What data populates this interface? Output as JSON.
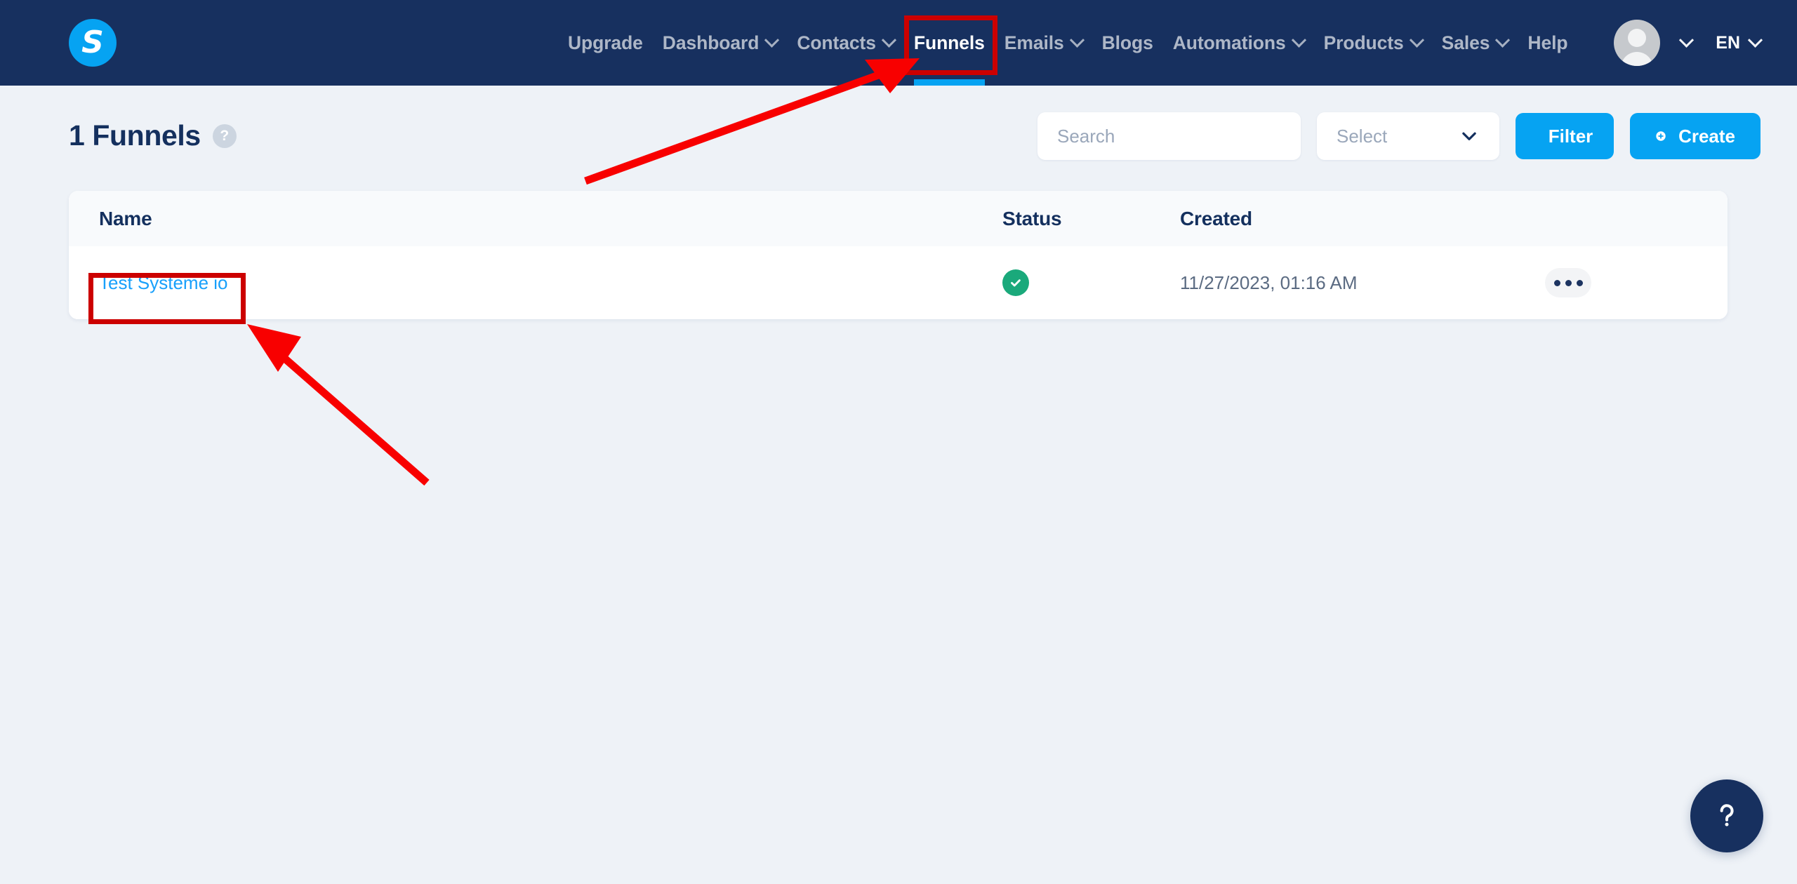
{
  "brand": {
    "letter": "S",
    "name": "systeme-io-logo"
  },
  "navbar": {
    "items": [
      {
        "label": "Upgrade",
        "has_dropdown": false,
        "active": false
      },
      {
        "label": "Dashboard",
        "has_dropdown": true,
        "active": false
      },
      {
        "label": "Contacts",
        "has_dropdown": true,
        "active": false
      },
      {
        "label": "Funnels",
        "has_dropdown": false,
        "active": true
      },
      {
        "label": "Emails",
        "has_dropdown": true,
        "active": false
      },
      {
        "label": "Blogs",
        "has_dropdown": false,
        "active": false
      },
      {
        "label": "Automations",
        "has_dropdown": true,
        "active": false
      },
      {
        "label": "Products",
        "has_dropdown": true,
        "active": false
      },
      {
        "label": "Sales",
        "has_dropdown": true,
        "active": false
      },
      {
        "label": "Help",
        "has_dropdown": false,
        "active": false
      }
    ],
    "language": "EN",
    "bg_color": "#17305f",
    "active_underline_color": "#06a3f2"
  },
  "header": {
    "title": "1 Funnels",
    "help_badge": "?"
  },
  "toolbar": {
    "search_placeholder": "Search",
    "search_value": "",
    "select_placeholder": "Select",
    "filter_label": "Filter",
    "create_label": "Create",
    "button_color": "#06a3f2"
  },
  "table": {
    "columns": [
      "Name",
      "Status",
      "Created"
    ],
    "rows": [
      {
        "name": "Test Systeme io",
        "status": "active",
        "status_color": "#1aa97b",
        "created": "11/27/2023, 01:16 AM"
      }
    ]
  },
  "fab": {
    "glyph": "?"
  },
  "annotations": {
    "color": "#cc0000",
    "boxes": [
      "funnels-nav-item",
      "funnel-name-link"
    ],
    "arrows": [
      "arrow-to-funnels-nav",
      "arrow-to-funnel-name"
    ]
  }
}
